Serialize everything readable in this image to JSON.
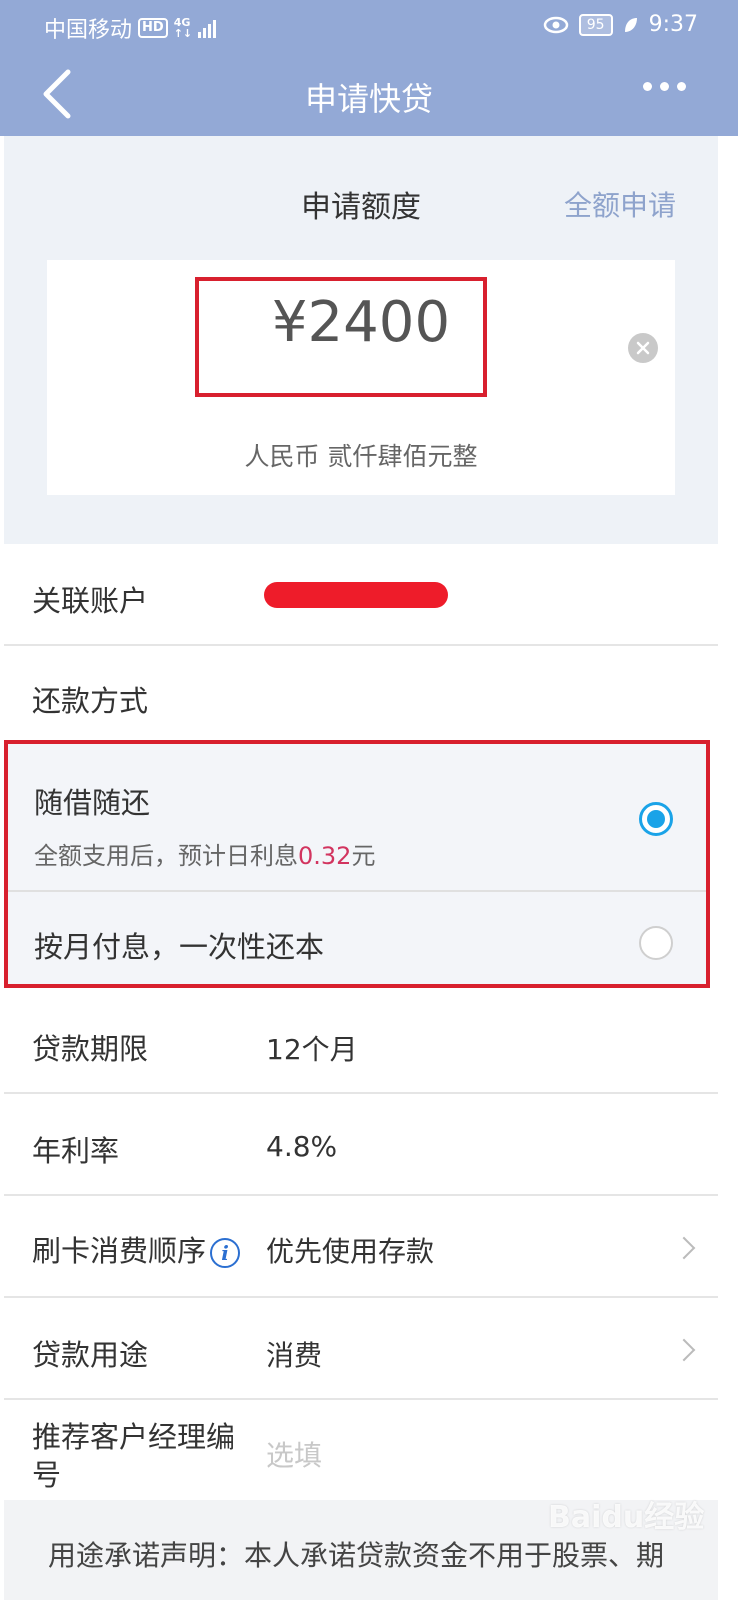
{
  "status_bar": {
    "carrier": "中国移动",
    "hd": "HD",
    "network_top": "4G",
    "network_bottom": "↑↓",
    "battery": "95",
    "time": "9:37"
  },
  "nav": {
    "title": "申请快贷",
    "back_icon": "chevron-left-icon",
    "more_icon": "more-dots-icon"
  },
  "amount": {
    "title": "申请额度",
    "full_apply": "全额申请",
    "value": "¥2400",
    "in_words": "人民币  贰仟肆佰元整",
    "clear_icon": "clear-circle-icon"
  },
  "linked_account": {
    "label": "关联账户"
  },
  "repayment": {
    "label": "还款方式",
    "options": [
      {
        "label": "随借随还",
        "sub_prefix": "全额支用后，预计日利息",
        "sub_highlight": "0.32",
        "sub_suffix": "元",
        "selected": true
      },
      {
        "label": "按月付息，一次性还本",
        "selected": false
      }
    ]
  },
  "term": {
    "label": "贷款期限",
    "value": "12个月"
  },
  "rate": {
    "label": "年利率",
    "value": "4.8%"
  },
  "card_order": {
    "label": "刷卡消费顺序",
    "value": "优先使用存款",
    "info_icon": "info-icon"
  },
  "purpose": {
    "label": "贷款用途",
    "value": "消费"
  },
  "manager": {
    "label_line1": "推荐客户经理编",
    "label_line2": "号",
    "placeholder": "选填"
  },
  "statement": {
    "text": "用途承诺声明：本人承诺贷款资金不用于股票、期"
  },
  "watermark": {
    "text": "Baidu经验"
  },
  "colors": {
    "header": "#93a9d6",
    "accent_radio": "#1aa3e8",
    "highlight": "#d2345f",
    "annotation_red": "#d8202e"
  }
}
